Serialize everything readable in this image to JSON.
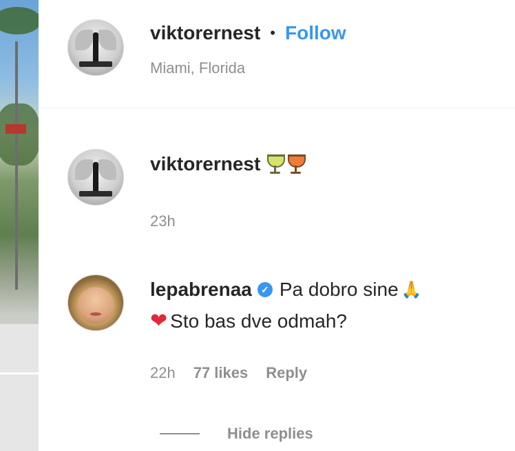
{
  "header": {
    "username": "viktorernest",
    "separator": "•",
    "follow_label": "Follow",
    "location": "Miami, Florida"
  },
  "caption": {
    "username": "viktorernest",
    "emoji": [
      "tropical-drink-green",
      "tropical-drink-orange"
    ],
    "time": "23h"
  },
  "comment": {
    "username": "lepabrenaa",
    "verified_glyph": "✓",
    "text_line1": "Pa dobro sine",
    "text_line2": "Sto bas dve odmah?",
    "pray_glyph": "🙏",
    "heart_glyph": "❤",
    "time": "22h",
    "likes": "77 likes",
    "reply_label": "Reply"
  },
  "replies": {
    "hide_label": "Hide replies"
  },
  "colors": {
    "link": "#3897f0",
    "muted": "#8e8e8e",
    "text": "#262626",
    "heart": "#e02a3a"
  }
}
